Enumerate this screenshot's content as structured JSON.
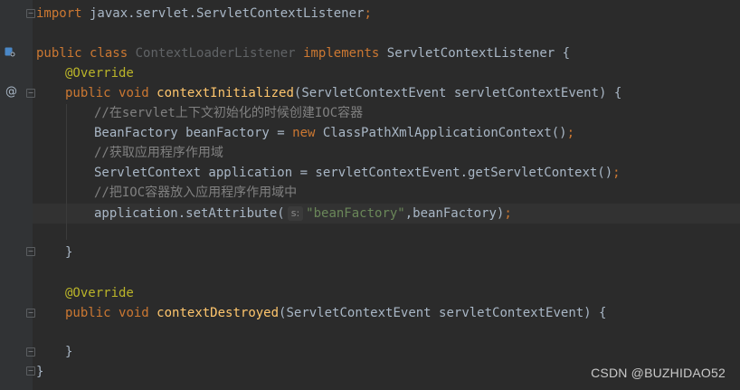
{
  "editor": {
    "lines": {
      "import_kw": "import",
      "import_path": " javax.servlet.ServletContextListener",
      "import_semi": ";",
      "class_public": "public",
      "class_kw": "class",
      "class_name": "ContextLoaderListener",
      "class_implements": "implements",
      "class_iface": "ServletContextListener",
      "class_brace": " {",
      "override_1": "@Override",
      "init_public": "public",
      "init_void": "void",
      "init_name": "contextInitialized",
      "init_params": "(ServletContextEvent servletContextEvent) {",
      "comment_1": "//在servlet上下文初始化的时候创建IOC容器",
      "bf_decl": "BeanFactory beanFactory = ",
      "bf_new": "new",
      "bf_ctor": " ClassPathXmlApplicationContext()",
      "bf_semi": ";",
      "comment_2": "//获取应用程序作用域",
      "app_decl": "ServletContext application = servletContextEvent.getServletContext()",
      "app_semi": ";",
      "comment_3": "//把IOC容器放入应用程序作用域中",
      "set_call": "application.setAttribute(",
      "set_hint": "s:",
      "set_key": "\"beanFactory\"",
      "set_rest": ",beanFactory)",
      "set_semi": ";",
      "close_1": "}",
      "override_2": "@Override",
      "destroy_public": "public",
      "destroy_void": "void",
      "destroy_name": "contextDestroyed",
      "destroy_params": "(ServletContextEvent servletContextEvent) {",
      "close_2": "}",
      "close_class": "}"
    },
    "gutter": {
      "at_marker": "@"
    }
  },
  "watermark": "CSDN @BUZHIDAO52",
  "colors": {
    "background": "#2b2b2b",
    "gutter": "#313335",
    "keyword": "#cc7832",
    "annotation": "#bbb529",
    "method": "#ffc66d",
    "string": "#6a8759",
    "comment": "#808080",
    "unused": "#606366",
    "text": "#a9b7c6"
  }
}
